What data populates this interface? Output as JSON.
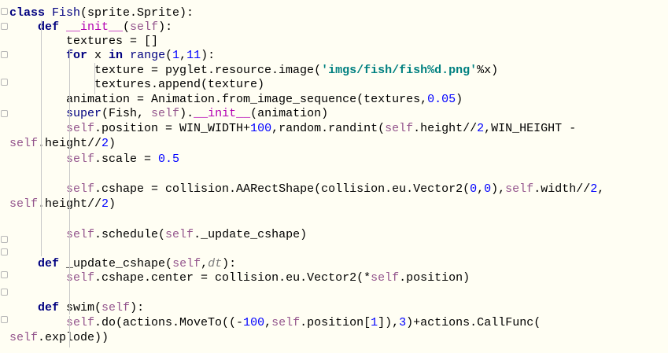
{
  "editor": {
    "lines": [
      [
        {
          "t": "class ",
          "c": "kw"
        },
        {
          "t": "Fish",
          "c": "name-fish"
        },
        {
          "t": "(sprite.Sprite):",
          "c": ""
        }
      ],
      [
        {
          "t": "    def ",
          "c": "kw"
        },
        {
          "t": "__init__",
          "c": "magic"
        },
        {
          "t": "(",
          "c": ""
        },
        {
          "t": "self",
          "c": "selfk"
        },
        {
          "t": "):",
          "c": ""
        }
      ],
      [
        {
          "t": "        textures = []",
          "c": ""
        }
      ],
      [
        {
          "t": "        for ",
          "c": "kw"
        },
        {
          "t": "x ",
          "c": ""
        },
        {
          "t": "in ",
          "c": "kw"
        },
        {
          "t": "range",
          "c": "bi"
        },
        {
          "t": "(",
          "c": ""
        },
        {
          "t": "1",
          "c": "num"
        },
        {
          "t": ",",
          "c": ""
        },
        {
          "t": "11",
          "c": "num"
        },
        {
          "t": "):",
          "c": ""
        }
      ],
      [
        {
          "t": "            texture = pyglet.resource.image(",
          "c": ""
        },
        {
          "t": "'imgs/fish/fish%d.png'",
          "c": "str"
        },
        {
          "t": "%x)",
          "c": ""
        }
      ],
      [
        {
          "t": "            textures.append(texture)",
          "c": ""
        }
      ],
      [
        {
          "t": "        animation = Animation.from_image_sequence(textures,",
          "c": ""
        },
        {
          "t": "0.05",
          "c": "num"
        },
        {
          "t": ")",
          "c": ""
        }
      ],
      [
        {
          "t": "        ",
          "c": ""
        },
        {
          "t": "super",
          "c": "bi"
        },
        {
          "t": "(Fish, ",
          "c": ""
        },
        {
          "t": "self",
          "c": "selfk"
        },
        {
          "t": ").",
          "c": ""
        },
        {
          "t": "__init__",
          "c": "magic"
        },
        {
          "t": "(animation)",
          "c": ""
        }
      ],
      [
        {
          "t": "        ",
          "c": ""
        },
        {
          "t": "self",
          "c": "selfk"
        },
        {
          "t": ".position = WIN_WIDTH+",
          "c": ""
        },
        {
          "t": "100",
          "c": "num"
        },
        {
          "t": ",random.randint(",
          "c": ""
        },
        {
          "t": "self",
          "c": "selfk"
        },
        {
          "t": ".height//",
          "c": ""
        },
        {
          "t": "2",
          "c": "num"
        },
        {
          "t": ",WIN_HEIGHT -",
          "c": ""
        }
      ],
      [
        {
          "t": "self",
          "c": "selfk"
        },
        {
          "t": ".height//",
          "c": ""
        },
        {
          "t": "2",
          "c": "num"
        },
        {
          "t": ")",
          "c": ""
        }
      ],
      [
        {
          "t": "        ",
          "c": ""
        },
        {
          "t": "self",
          "c": "selfk"
        },
        {
          "t": ".scale = ",
          "c": ""
        },
        {
          "t": "0.5",
          "c": "num"
        }
      ],
      [
        {
          "t": "",
          "c": ""
        }
      ],
      [
        {
          "t": "        ",
          "c": ""
        },
        {
          "t": "self",
          "c": "selfk"
        },
        {
          "t": ".cshape = collision.AARectShape(collision.eu.Vector2(",
          "c": ""
        },
        {
          "t": "0",
          "c": "num"
        },
        {
          "t": ",",
          "c": ""
        },
        {
          "t": "0",
          "c": "num"
        },
        {
          "t": "),",
          "c": ""
        },
        {
          "t": "self",
          "c": "selfk"
        },
        {
          "t": ".width//",
          "c": ""
        },
        {
          "t": "2",
          "c": "num"
        },
        {
          "t": ",",
          "c": ""
        }
      ],
      [
        {
          "t": "self",
          "c": "selfk"
        },
        {
          "t": ".height//",
          "c": ""
        },
        {
          "t": "2",
          "c": "num"
        },
        {
          "t": ")",
          "c": ""
        }
      ],
      [
        {
          "t": "",
          "c": ""
        }
      ],
      [
        {
          "t": "        ",
          "c": ""
        },
        {
          "t": "self",
          "c": "selfk"
        },
        {
          "t": ".schedule(",
          "c": ""
        },
        {
          "t": "self",
          "c": "selfk"
        },
        {
          "t": "._update_cshape)",
          "c": ""
        }
      ],
      [
        {
          "t": "",
          "c": ""
        }
      ],
      [
        {
          "t": "    def ",
          "c": "kw"
        },
        {
          "t": "_update_cshape",
          "c": "def-name"
        },
        {
          "t": "(",
          "c": ""
        },
        {
          "t": "self",
          "c": "selfk"
        },
        {
          "t": ",",
          "c": ""
        },
        {
          "t": "dt",
          "c": "param"
        },
        {
          "t": "):",
          "c": ""
        }
      ],
      [
        {
          "t": "        ",
          "c": ""
        },
        {
          "t": "self",
          "c": "selfk"
        },
        {
          "t": ".cshape.center = collision.eu.Vector2(*",
          "c": ""
        },
        {
          "t": "self",
          "c": "selfk"
        },
        {
          "t": ".position)",
          "c": ""
        }
      ],
      [
        {
          "t": "",
          "c": ""
        }
      ],
      [
        {
          "t": "    def ",
          "c": "kw"
        },
        {
          "t": "swim",
          "c": "def-name"
        },
        {
          "t": "(",
          "c": ""
        },
        {
          "t": "self",
          "c": "selfk"
        },
        {
          "t": "):",
          "c": ""
        }
      ],
      [
        {
          "t": "        ",
          "c": ""
        },
        {
          "t": "self",
          "c": "selfk"
        },
        {
          "t": ".do(actions.MoveTo((-",
          "c": ""
        },
        {
          "t": "100",
          "c": "num"
        },
        {
          "t": ",",
          "c": ""
        },
        {
          "t": "self",
          "c": "selfk"
        },
        {
          "t": ".position[",
          "c": ""
        },
        {
          "t": "1",
          "c": "num"
        },
        {
          "t": "]),",
          "c": ""
        },
        {
          "t": "3",
          "c": "num"
        },
        {
          "t": ")+actions.CallFunc(",
          "c": ""
        }
      ],
      [
        {
          "t": "self",
          "c": "selfk"
        },
        {
          "t": ".explode))",
          "c": ""
        }
      ]
    ],
    "colors": {
      "background": "#fffef3",
      "keyword": "#000080",
      "self": "#94558d",
      "number": "#0000ff",
      "string": "#008080",
      "magic": "#b200b2"
    }
  }
}
